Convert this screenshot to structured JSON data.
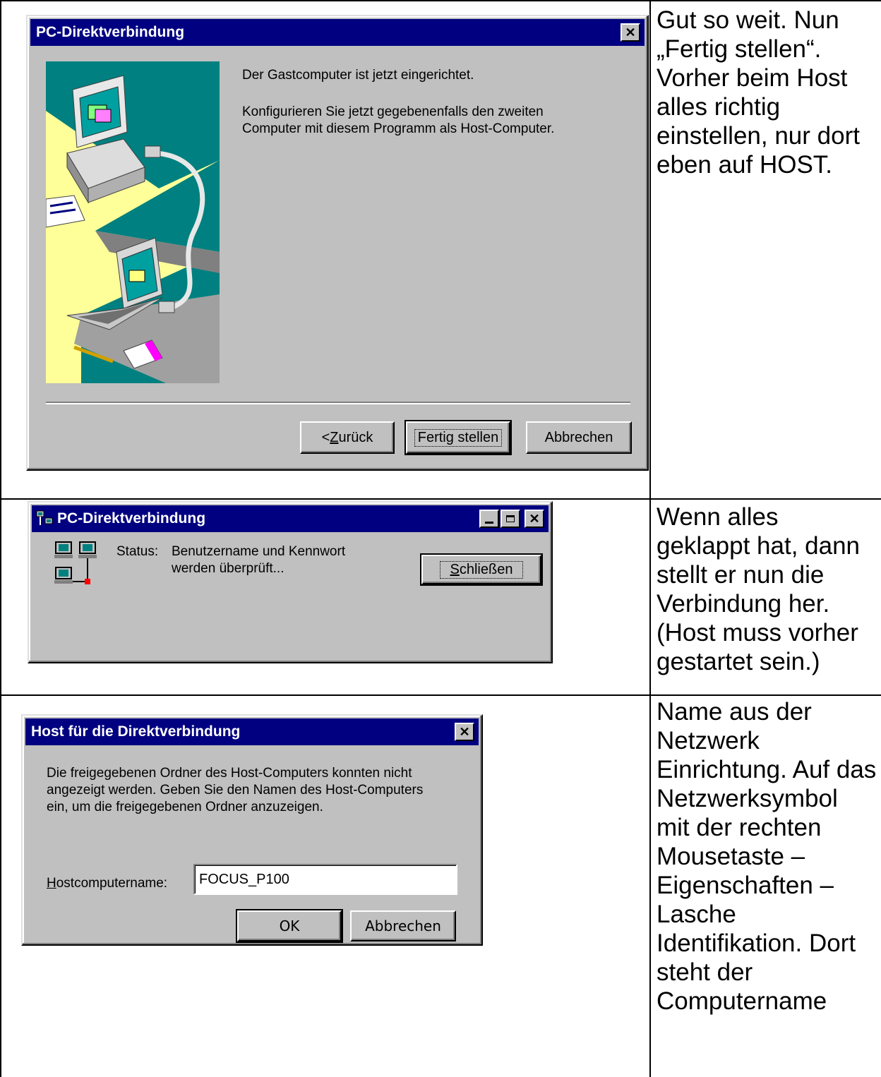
{
  "row1": {
    "dialog": {
      "title": "PC-Direktverbindung",
      "line1": "Der Gastcomputer ist jetzt eingerichtet.",
      "line2": "Konfigurieren Sie jetzt gegebenenfalls den zweiten Computer mit diesem Programm als Host-Computer.",
      "back_prefix": "< ",
      "back_hotkey": "Z",
      "back_rest": "urück",
      "finish_label": "Fertig stellen",
      "cancel_label": "Abbrechen"
    },
    "note": "Gut so weit. Nun „Fertig stellen“. Vorher beim Host alles richtig einstellen, nur dort eben auf HOST."
  },
  "row2": {
    "dialog": {
      "title": "PC-Direktverbindung",
      "status_label": "Status:",
      "status_text": "Benutzername und Kennwort werden überprüft...",
      "close_hotkey": "S",
      "close_rest": "chließen"
    },
    "note": "Wenn alles geklappt hat, dann stellt er nun die Verbindung her. (Host muss vorher gestartet sein.)"
  },
  "row3": {
    "dialog": {
      "title": "Host für die Direktverbindung",
      "message": "Die freigegebenen Ordner des Host-Computers konnten nicht angezeigt werden. Geben Sie den Namen des Host-Computers ein, um die freigegebenen Ordner anzuzeigen.",
      "field_hotkey": "H",
      "field_rest": "ostcomputername:",
      "field_value": "FOCUS_P100",
      "ok_label": "OK",
      "cancel_label": "Abbrechen"
    },
    "note": "Name aus der Netzwerk Einrichtung. Auf das Netzwerksymbol mit der rechten Mousetaste – Eigenschaften – Lasche Identifikation. Dort steht der Computername"
  },
  "icons": [
    "close-icon",
    "minimize-icon",
    "maximize-icon",
    "dcc-app-icon",
    "network-computers-icon"
  ],
  "colors": {
    "titlebar": "#000080",
    "dialog_face": "#c0c0c0",
    "wizard_teal": "#008080",
    "wizard_yellow": "#ffff99"
  }
}
